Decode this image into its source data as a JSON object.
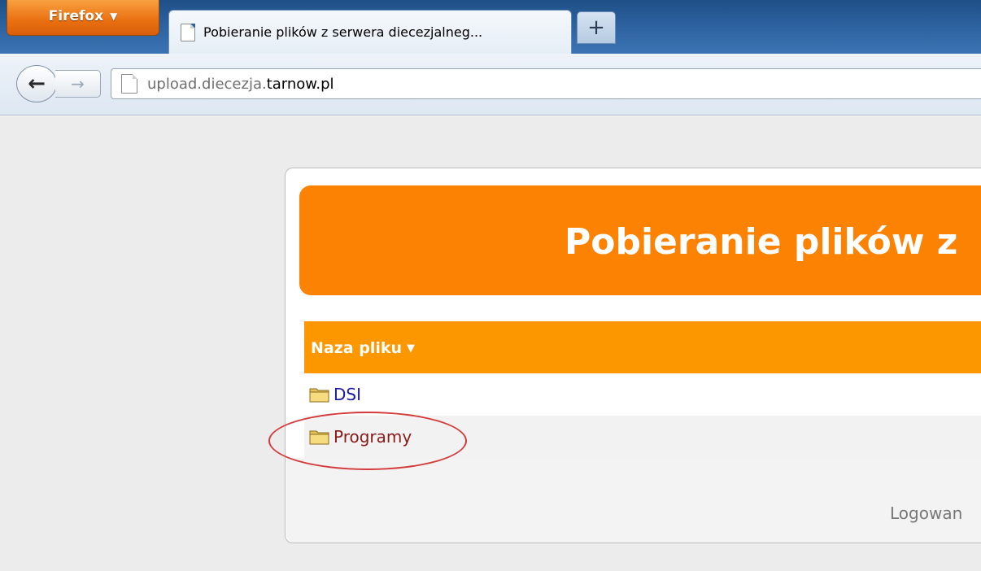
{
  "browser": {
    "menu_button_label": "Firefox",
    "tab_title": "Pobieranie plików z serwera diecezjalneg...",
    "new_tab_glyph": "+",
    "back_glyph": "🡐",
    "forward_glyph": "➜",
    "url_prefix": "upload.diecezja.",
    "url_host": "tarnow.pl"
  },
  "page": {
    "title": "Pobieranie plików z",
    "table": {
      "column_header": "Naza pliku",
      "sort_glyph": "▼",
      "rows": [
        {
          "name": "DSI",
          "icon": "folder-icon"
        },
        {
          "name": "Programy",
          "icon": "folder-icon"
        }
      ]
    },
    "footer_text": "Logowan"
  },
  "colors": {
    "header_orange": "#fb8203",
    "table_header_orange": "#fd9700",
    "link_blue": "#1a1aa6",
    "visited_link": "#8a1a1a",
    "annotation_red": "#d43a3a"
  }
}
